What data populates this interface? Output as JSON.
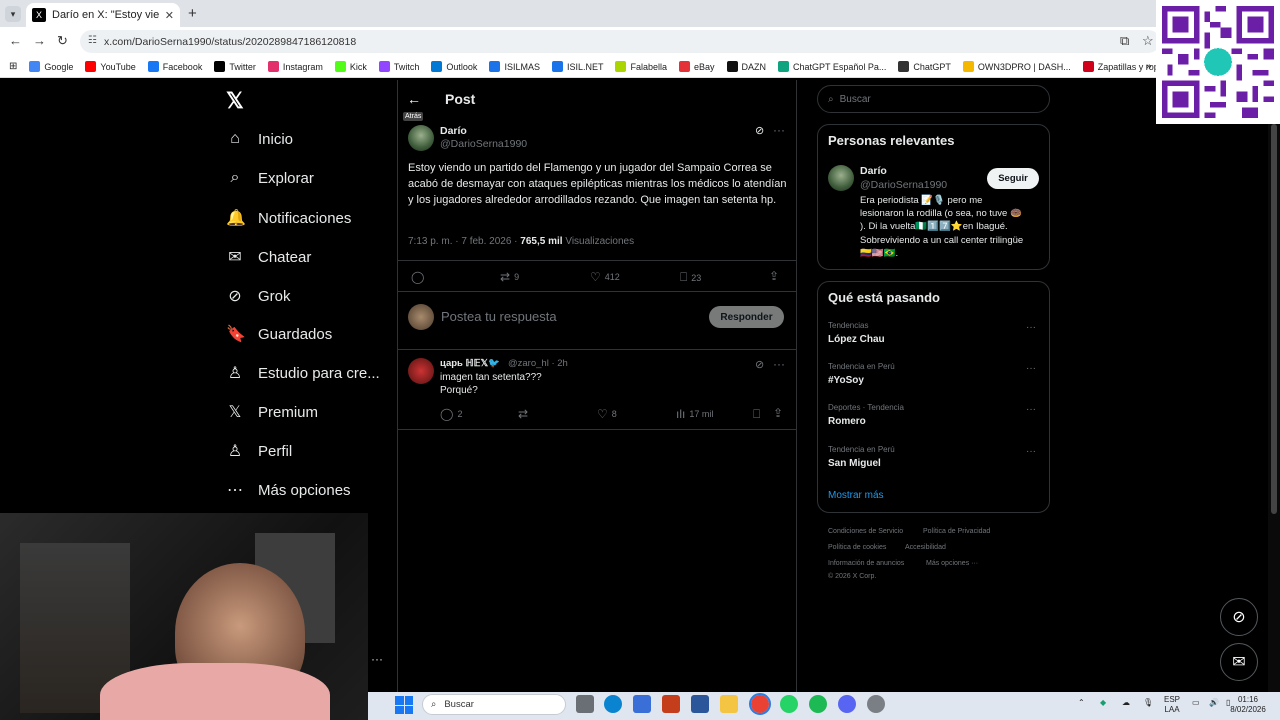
{
  "browser": {
    "tab_title": "Darío en X: \"Estoy viendo un p...",
    "tab_favicon": "X",
    "new_tab": "+",
    "url": "x.com/DarioSerna1990/status/2020289847186120818",
    "bookmarks": [
      {
        "label": "Google",
        "color": "#4285f4"
      },
      {
        "label": "YouTube",
        "color": "#ff0000"
      },
      {
        "label": "Facebook",
        "color": "#1877f2"
      },
      {
        "label": "Twitter",
        "color": "#000000"
      },
      {
        "label": "Instagram",
        "color": "#e1306c"
      },
      {
        "label": "Kick",
        "color": "#53fc18"
      },
      {
        "label": "Twitch",
        "color": "#9146ff"
      },
      {
        "label": "Outlook",
        "color": "#0078d4"
      },
      {
        "label": "ISILMAS",
        "color": "#1a73e8"
      },
      {
        "label": "ISIL.NET",
        "color": "#1a73e8"
      },
      {
        "label": "Falabella",
        "color": "#aad500"
      },
      {
        "label": "eBay",
        "color": "#e53238"
      },
      {
        "label": "DAZN",
        "color": "#111111"
      },
      {
        "label": "ChatGPT Español Pa...",
        "color": "#10a37f"
      },
      {
        "label": "ChatGPT",
        "color": "#333333"
      },
      {
        "label": "OWN3DPRO | DASH...",
        "color": "#f5b800"
      },
      {
        "label": "Zapatillas y ropa de...",
        "color": "#d0021b"
      }
    ]
  },
  "nav": {
    "items": [
      {
        "label": "Inicio",
        "icon": "⌂"
      },
      {
        "label": "Explorar",
        "icon": "⌕"
      },
      {
        "label": "Notificaciones",
        "icon": "🔔"
      },
      {
        "label": "Chatear",
        "icon": "✉"
      },
      {
        "label": "Grok",
        "icon": "⊘"
      },
      {
        "label": "Guardados",
        "icon": "🔖"
      },
      {
        "label": "Estudio para cre...",
        "icon": "♙"
      },
      {
        "label": "Premium",
        "icon": "𝕏"
      },
      {
        "label": "Perfil",
        "icon": "♙"
      },
      {
        "label": "Más opciones",
        "icon": "⋯"
      }
    ]
  },
  "header": {
    "title": "Post",
    "back_tooltip": "Atrás"
  },
  "post": {
    "name": "Darío",
    "handle": "@DarioSerna1990",
    "text": "Estoy viendo un partido del Flamengo y un jugador del Sampaio Correa se acabó de desmayar con ataques epilépticas mientras los médicos lo atendían y los jugadores alrededor arrodillados rezando. Que imagen tan setenta hp.",
    "meta": "7:13 p. m. · 7 feb. 2026 · ",
    "views": "765,5 mil",
    "views_label": " Visualizaciones",
    "retweets": "9",
    "likes": "412",
    "bookmarks": "23"
  },
  "compose": {
    "placeholder": "Postea tu respuesta",
    "button": "Responder"
  },
  "reply": {
    "name": "царь ℍ𝔼𝕏🐦",
    "handle": "@zaro_hl · 2h",
    "line1": "imagen tan setenta???",
    "line2": "Porqué?",
    "replies": "2",
    "likes": "8",
    "views": "17 mil"
  },
  "search": {
    "placeholder": "Buscar"
  },
  "relevant": {
    "title": "Personas relevantes",
    "name": "Darío",
    "handle": "@DarioSerna1990",
    "follow": "Seguir",
    "bio1": "Era periodista 📝🎙️ pero me",
    "bio2": "lesionaron la rodilla (o sea, no tuve 🍩",
    "bio3": "). Di la vuelta🇳🇬1️⃣7️⃣⭐en Ibagué.",
    "bio4": "Sobreviviendo a un call center trilingüe",
    "bio5": "🇨🇴🇺🇸🇧🇷."
  },
  "trends": {
    "title": "Qué está pasando",
    "items": [
      {
        "context": "Tendencias",
        "name": "López Chau"
      },
      {
        "context": "Tendencia en Perú",
        "name": "#YoSoy"
      },
      {
        "context": "Deportes · Tendencia",
        "name": "Romero"
      },
      {
        "context": "Tendencia en Perú",
        "name": "San Miguel"
      }
    ],
    "show_more": "Mostrar más"
  },
  "footer": {
    "l1a": "Condiciones de Servicio",
    "l1b": "Política de Privacidad",
    "l2a": "Política de cookies",
    "l2b": "Accesibilidad",
    "l3a": "Información de anuncios",
    "l3b": "Más opciones ···",
    "copy": "© 2026 X Corp."
  },
  "taskbar": {
    "search": "Buscar",
    "lang1": "ESP",
    "lang2": "LAA",
    "time": "01:16",
    "date": "8/02/2026"
  },
  "colors": {
    "accent": "#1d9bf0",
    "bg": "#000000",
    "text": "#e7e9ea",
    "muted": "#71767b"
  }
}
